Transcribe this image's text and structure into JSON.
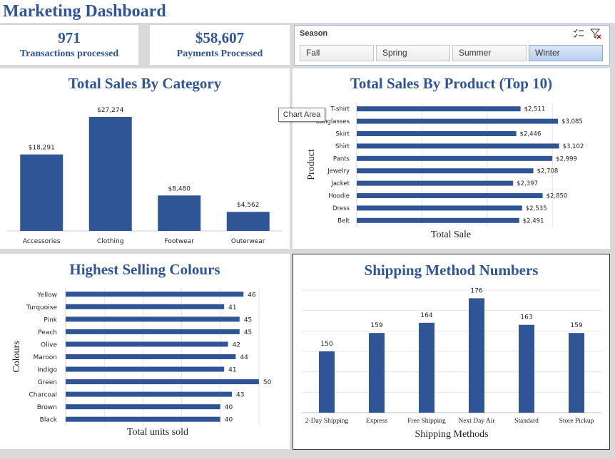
{
  "dashboard": {
    "title": "Marketing Dashboard"
  },
  "kpis": [
    {
      "value": "971",
      "label": "Transactions processed"
    },
    {
      "value": "$58,607",
      "label": "Payments Processed"
    }
  ],
  "slicer": {
    "title": "Season",
    "buttons": [
      "Fall",
      "Spring",
      "Summer",
      "Winter"
    ],
    "selected": "Winter",
    "icons": [
      "multi-select-icon",
      "clear-filter-icon"
    ]
  },
  "tooltip": {
    "text": "Chart Area"
  },
  "colors": {
    "accent": "#2e5597",
    "bar": "#2f5597"
  },
  "chart_data": [
    {
      "type": "bar",
      "title": "Total Sales By Category",
      "categories": [
        "Accessories",
        "Clothing",
        "Footwear",
        "Outerwear"
      ],
      "values": [
        18291,
        27274,
        8480,
        4562
      ],
      "data_labels": [
        "$18,291",
        "$27,274",
        "$8,480",
        "$4,562"
      ],
      "ylim": [
        0,
        30000
      ],
      "grid": false
    },
    {
      "type": "bar",
      "orientation": "horizontal",
      "title": "Total Sales By Product (Top 10)",
      "categories": [
        "T-shirt",
        "Sunglasses",
        "Skirt",
        "Shirt",
        "Pants",
        "Jewelry",
        "Jacket",
        "Hoodie",
        "Dress",
        "Belt"
      ],
      "values": [
        2511,
        3085,
        2446,
        3102,
        2999,
        2708,
        2397,
        2850,
        2535,
        2491
      ],
      "data_labels": [
        "$2,511",
        "$3,085",
        "$2,446",
        "$3,102",
        "$2,999",
        "$2,708",
        "$2,397",
        "$2,850",
        "$2,535",
        "$2,491"
      ],
      "xlabel": "Total Sale",
      "ylabel": "Product",
      "xlim": [
        0,
        3500
      ],
      "grid": true
    },
    {
      "type": "bar",
      "orientation": "horizontal",
      "title": "Highest Selling Colours",
      "categories": [
        "Yellow",
        "Turquoise",
        "Pink",
        "Peach",
        "Olive",
        "Maroon",
        "Indigo",
        "Green",
        "Charcoal",
        "Brown",
        "Black"
      ],
      "values": [
        46,
        41,
        45,
        45,
        42,
        44,
        41,
        50,
        43,
        40,
        40
      ],
      "xlabel": "Total units sold",
      "ylabel": "Colours",
      "xlim": [
        0,
        55
      ],
      "grid": true
    },
    {
      "type": "bar",
      "title": "Shipping Method Numbers",
      "categories": [
        "2-Day Shipping",
        "Express",
        "Free Shipping",
        "Next Day Air",
        "Standard",
        "Store Pickup"
      ],
      "values": [
        150,
        159,
        164,
        176,
        163,
        159
      ],
      "xlabel": "Shipping Methods",
      "ylim": [
        120,
        180
      ],
      "grid": true
    }
  ]
}
